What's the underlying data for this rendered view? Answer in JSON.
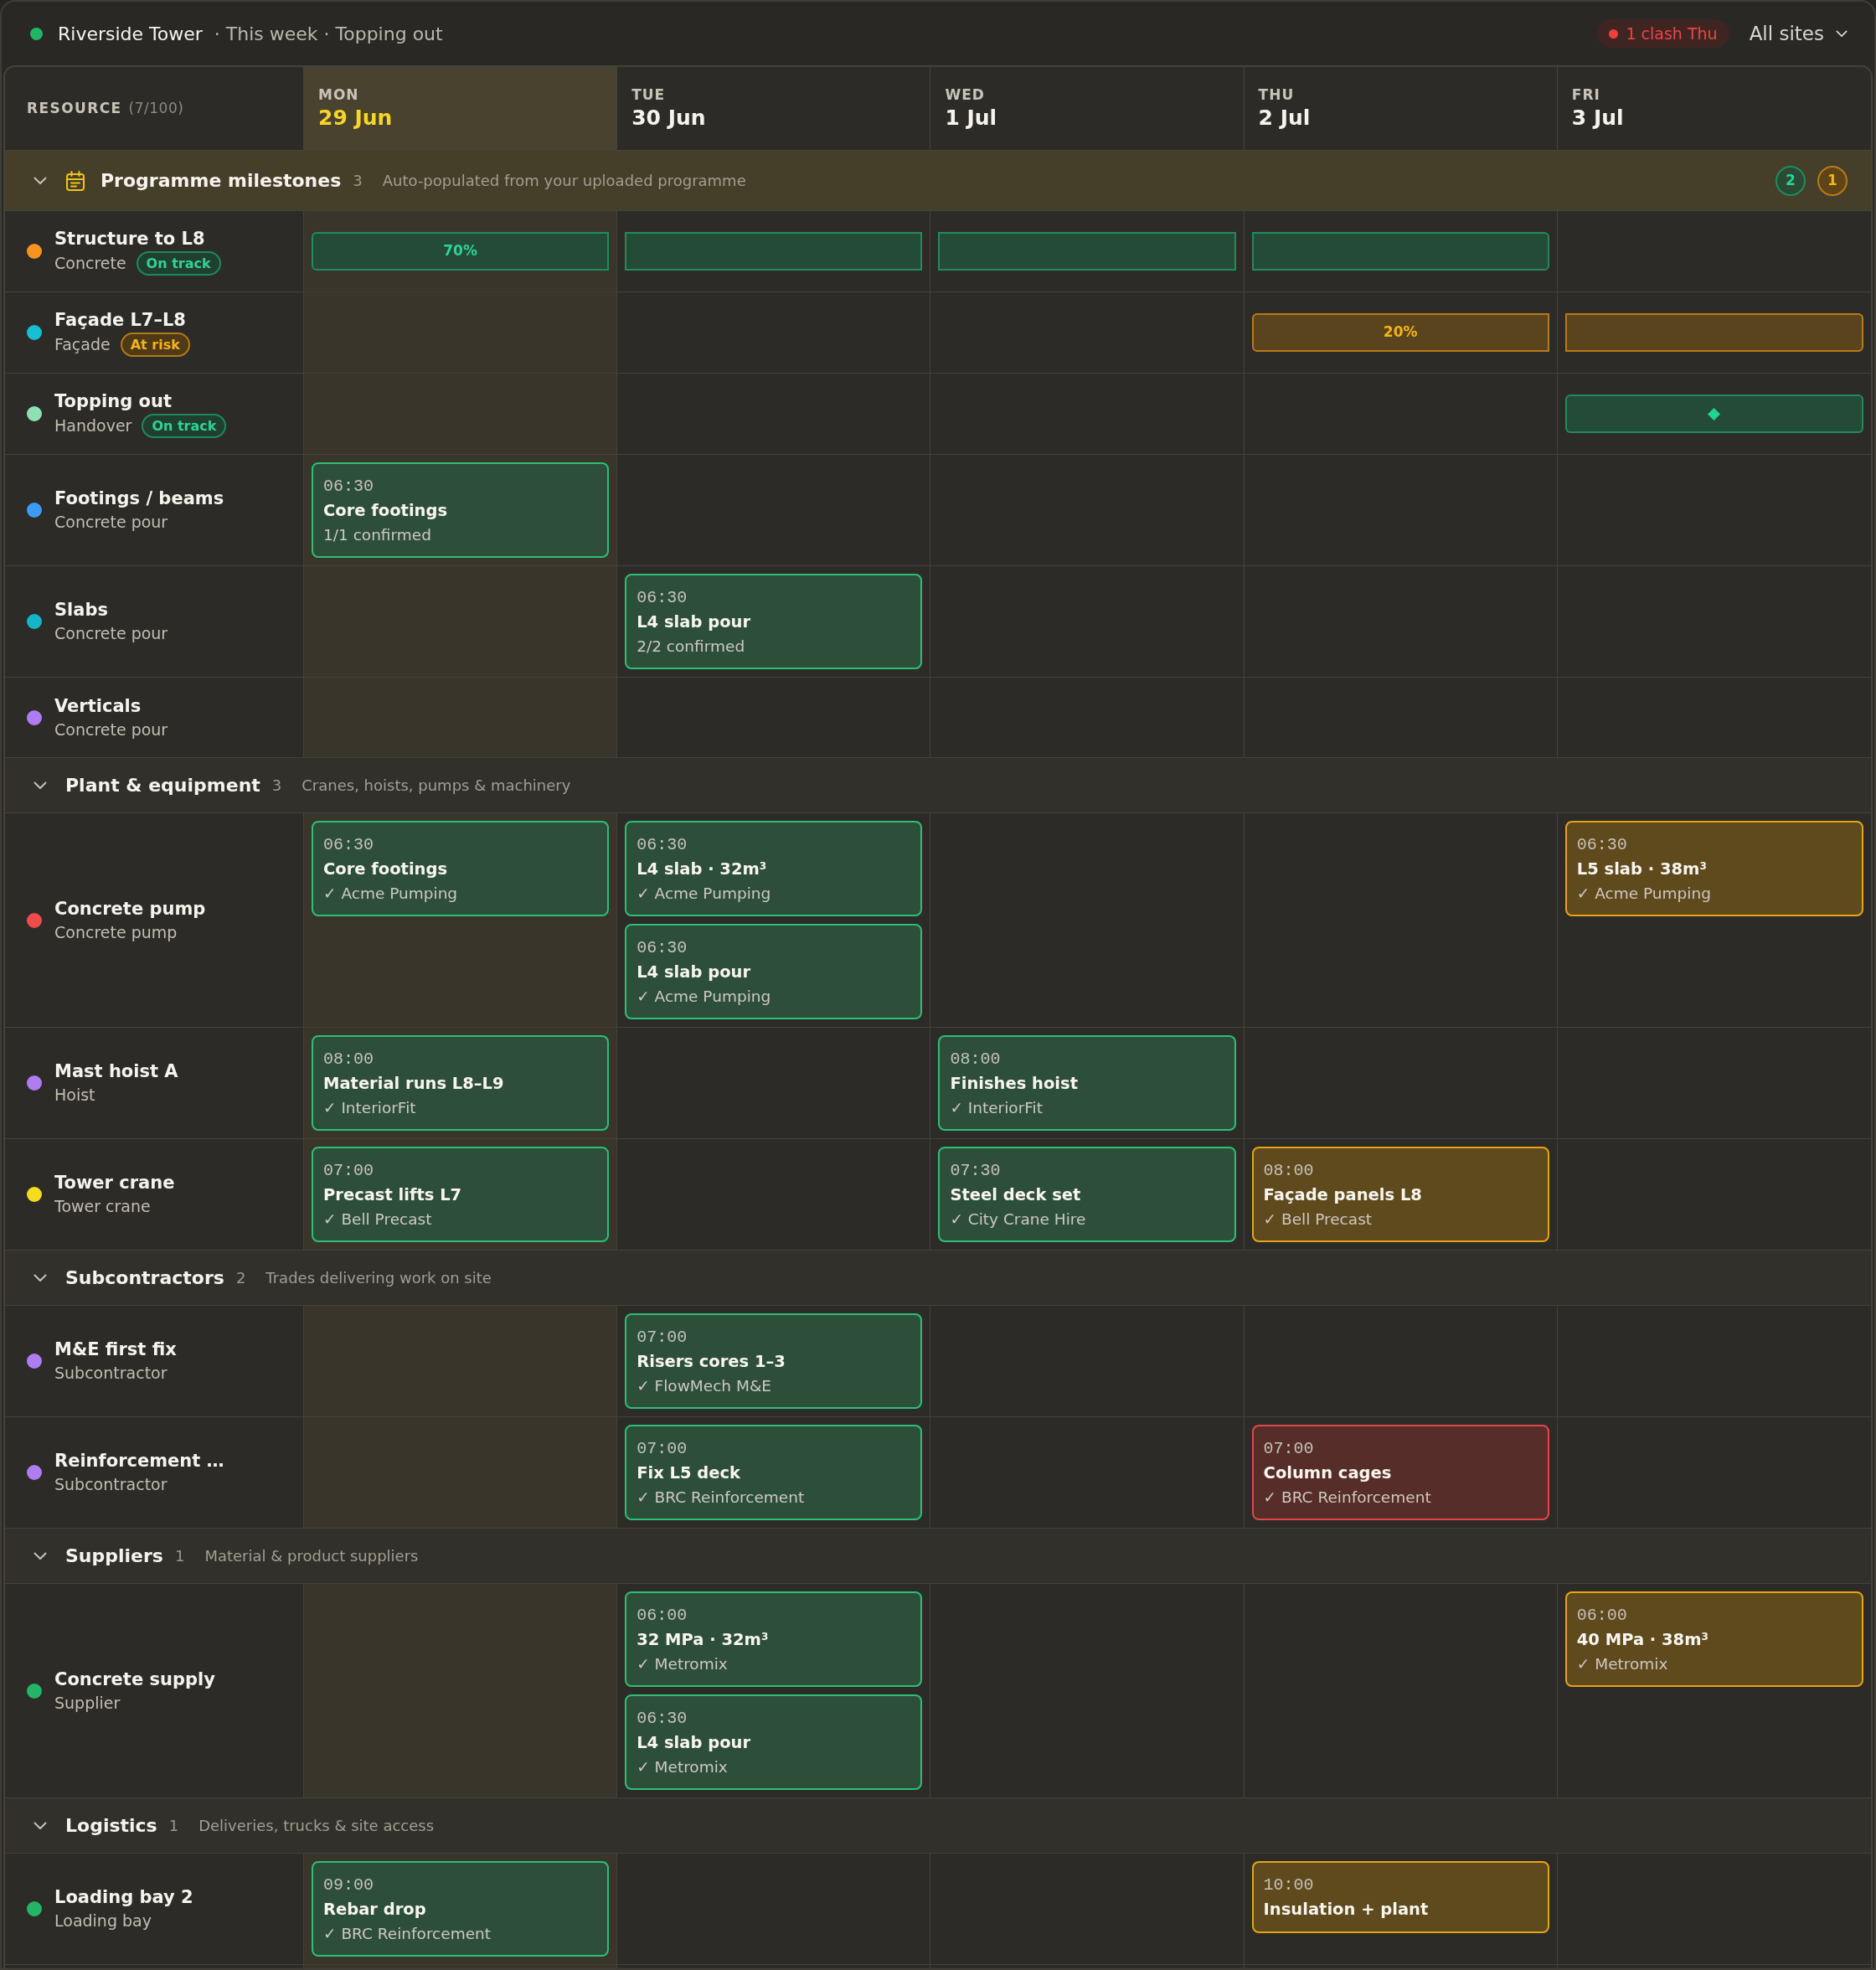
{
  "topbar": {
    "title": "Riverside Tower",
    "subtitle": "· This week · Topping out",
    "alert": "1 clash Thu",
    "site_filter": "All sites"
  },
  "grid": {
    "resource_header": {
      "label": "RESOURCE",
      "count": "(7/100)"
    },
    "days": [
      {
        "name": "MON",
        "date": "29 Jun",
        "today": true
      },
      {
        "name": "TUE",
        "date": "30 Jun",
        "today": false
      },
      {
        "name": "WED",
        "date": "1 Jul",
        "today": false
      },
      {
        "name": "THU",
        "date": "2 Jul",
        "today": false
      },
      {
        "name": "FRI",
        "date": "3 Jul",
        "today": false
      }
    ],
    "groups": [
      {
        "kind": "milestones",
        "name": "Programme milestones",
        "count": "3",
        "description": "Auto-populated from your uploaded programme",
        "expanded": true,
        "badges": [
          {
            "label": "2",
            "kind": "on_track"
          },
          {
            "label": "1",
            "kind": "at_risk"
          }
        ],
        "rows": [
          {
            "kind": "milestone",
            "name": "Structure to L8",
            "category": "Concrete",
            "color": "#f7931e",
            "status": {
              "label": "On track",
              "kind": "on_track"
            },
            "bar": {
              "kind": "progress",
              "label": "70%",
              "span": [
                true,
                true,
                true,
                true,
                false
              ]
            }
          },
          {
            "kind": "milestone",
            "name": "Façade L7–L8",
            "category": "Façade",
            "color": "#16bfd3",
            "status": {
              "label": "At risk",
              "kind": "at_risk"
            },
            "bar": {
              "kind": "progress",
              "label": "20%",
              "span": [
                false,
                false,
                false,
                true,
                true
              ]
            }
          },
          {
            "kind": "milestone",
            "name": "Topping out",
            "category": "Handover",
            "color": "#8fe0b4",
            "status": {
              "label": "On track",
              "kind": "on_track"
            },
            "bar": {
              "kind": "marker",
              "span": [
                false,
                false,
                false,
                false,
                true
              ]
            }
          },
          {
            "kind": "resource",
            "name": "Footings / beams",
            "category": "Concrete pour",
            "color": "#3d9bf5",
            "cells": [
              {
                "events": [
                  {
                    "time": "06:30",
                    "title": "Core footings",
                    "detail": "1/1 confirmed",
                    "kind": "confirmed"
                  }
                ]
              },
              null,
              null,
              null,
              null
            ]
          },
          {
            "kind": "resource",
            "name": "Slabs",
            "category": "Concrete pour",
            "color": "#16b5c9",
            "cells": [
              null,
              {
                "events": [
                  {
                    "time": "06:30",
                    "title": "L4 slab pour",
                    "detail": "2/2 confirmed",
                    "kind": "confirmed"
                  }
                ]
              },
              null,
              null,
              null
            ]
          },
          {
            "kind": "resource",
            "name": "Verticals",
            "category": "Concrete pour",
            "color": "#b07cf2"
          }
        ]
      },
      {
        "kind": "resources",
        "name": "Plant & equipment",
        "count": "3",
        "description": "Cranes, hoists, pumps & machinery",
        "expanded": true,
        "rows": [
          {
            "kind": "resource",
            "name": "Concrete pump",
            "category": "Concrete pump",
            "color": "#ef4b4b",
            "cells": [
              {
                "events": [
                  {
                    "time": "06:30",
                    "title": "Core footings",
                    "detail": "✓ Acme Pumping",
                    "kind": "confirmed"
                  }
                ]
              },
              {
                "events": [
                  {
                    "time": "06:30",
                    "title": "L4 slab · 32m$^{3}$",
                    "detail": "✓ Acme Pumping",
                    "kind": "confirmed"
                  },
                  {
                    "time": "06:30",
                    "title": "L4 slab pour",
                    "detail": "✓ Acme Pumping",
                    "kind": "confirmed"
                  }
                ]
              },
              null,
              null,
              {
                "events": [
                  {
                    "time": "06:30",
                    "title": "L5 slab · 38m$^{3}$",
                    "detail": "✓ Acme Pumping",
                    "kind": "tentative"
                  }
                ]
              }
            ]
          },
          {
            "kind": "resource",
            "name": "Mast hoist A",
            "category": "Hoist",
            "color": "#b07cf2",
            "cells": [
              {
                "events": [
                  {
                    "time": "08:00",
                    "title": "Material runs L8–L9",
                    "detail": "✓ InteriorFit",
                    "kind": "confirmed"
                  }
                ]
              },
              null,
              {
                "events": [
                  {
                    "time": "08:00",
                    "title": "Finishes hoist",
                    "detail": "✓ InteriorFit",
                    "kind": "confirmed"
                  }
                ]
              },
              null,
              null
            ]
          },
          {
            "kind": "resource",
            "name": "Tower crane",
            "category": "Tower crane",
            "color": "#f5dc1e",
            "cells": [
              {
                "events": [
                  {
                    "time": "07:00",
                    "title": "Precast lifts L7",
                    "detail": "✓ Bell Precast",
                    "kind": "confirmed"
                  }
                ]
              },
              null,
              {
                "events": [
                  {
                    "time": "07:30",
                    "title": "Steel deck set",
                    "detail": "✓ City Crane Hire",
                    "kind": "confirmed"
                  }
                ]
              },
              {
                "events": [
                  {
                    "time": "08:00",
                    "title": "Façade panels L8",
                    "detail": "✓ Bell Precast",
                    "kind": "tentative"
                  }
                ]
              },
              null
            ]
          }
        ]
      },
      {
        "kind": "resources",
        "name": "Subcontractors",
        "count": "2",
        "description": "Trades delivering work on site",
        "expanded": true,
        "rows": [
          {
            "kind": "resource",
            "name": "M&E first fix",
            "category": "Subcontractor",
            "color": "#b07cf2",
            "cells": [
              null,
              {
                "events": [
                  {
                    "time": "07:00",
                    "title": "Risers cores 1–3",
                    "detail": "✓ FlowMech M&E",
                    "kind": "confirmed"
                  }
                ]
              },
              null,
              null,
              null
            ]
          },
          {
            "kind": "resource",
            "name": "Reinforcement …",
            "category": "Subcontractor",
            "color": "#b07cf2",
            "cells": [
              null,
              {
                "events": [
                  {
                    "time": "07:00",
                    "title": "Fix L5 deck",
                    "detail": "✓ BRC Reinforcement",
                    "kind": "confirmed"
                  }
                ]
              },
              null,
              {
                "events": [
                  {
                    "time": "07:00",
                    "title": "Column cages",
                    "detail": "✓ BRC Reinforcement",
                    "kind": "clash"
                  }
                ]
              },
              null
            ]
          }
        ]
      },
      {
        "kind": "resources",
        "name": "Suppliers",
        "count": "1",
        "description": "Material & product suppliers",
        "expanded": true,
        "rows": [
          {
            "kind": "resource",
            "name": "Concrete supply",
            "category": "Supplier",
            "color": "#22b566",
            "cells": [
              null,
              {
                "events": [
                  {
                    "time": "06:00",
                    "title": "32 MPa · 32m$^{3}$",
                    "detail": "✓ Metromix",
                    "kind": "confirmed"
                  },
                  {
                    "time": "06:30",
                    "title": "L4 slab pour",
                    "detail": "✓ Metromix",
                    "kind": "confirmed"
                  }
                ]
              },
              null,
              null,
              {
                "events": [
                  {
                    "time": "06:00",
                    "title": "40 MPa · 38m$^{3}$",
                    "detail": "✓ Metromix",
                    "kind": "tentative"
                  }
                ]
              }
            ]
          }
        ]
      },
      {
        "kind": "resources",
        "name": "Logistics",
        "count": "1",
        "description": "Deliveries, trucks & site access",
        "expanded": true,
        "rows": [
          {
            "kind": "resource",
            "name": "Loading bay 2",
            "category": "Loading bay",
            "color": "#22b566",
            "cells": [
              {
                "events": [
                  {
                    "time": "09:00",
                    "title": "Rebar drop",
                    "detail": "✓ BRC Reinforcement",
                    "kind": "confirmed"
                  }
                ]
              },
              null,
              null,
              {
                "events": [
                  {
                    "time": "10:00",
                    "title": "Insulation + plant",
                    "kind": "tentative"
                  }
                ]
              },
              null
            ]
          }
        ]
      }
    ]
  }
}
